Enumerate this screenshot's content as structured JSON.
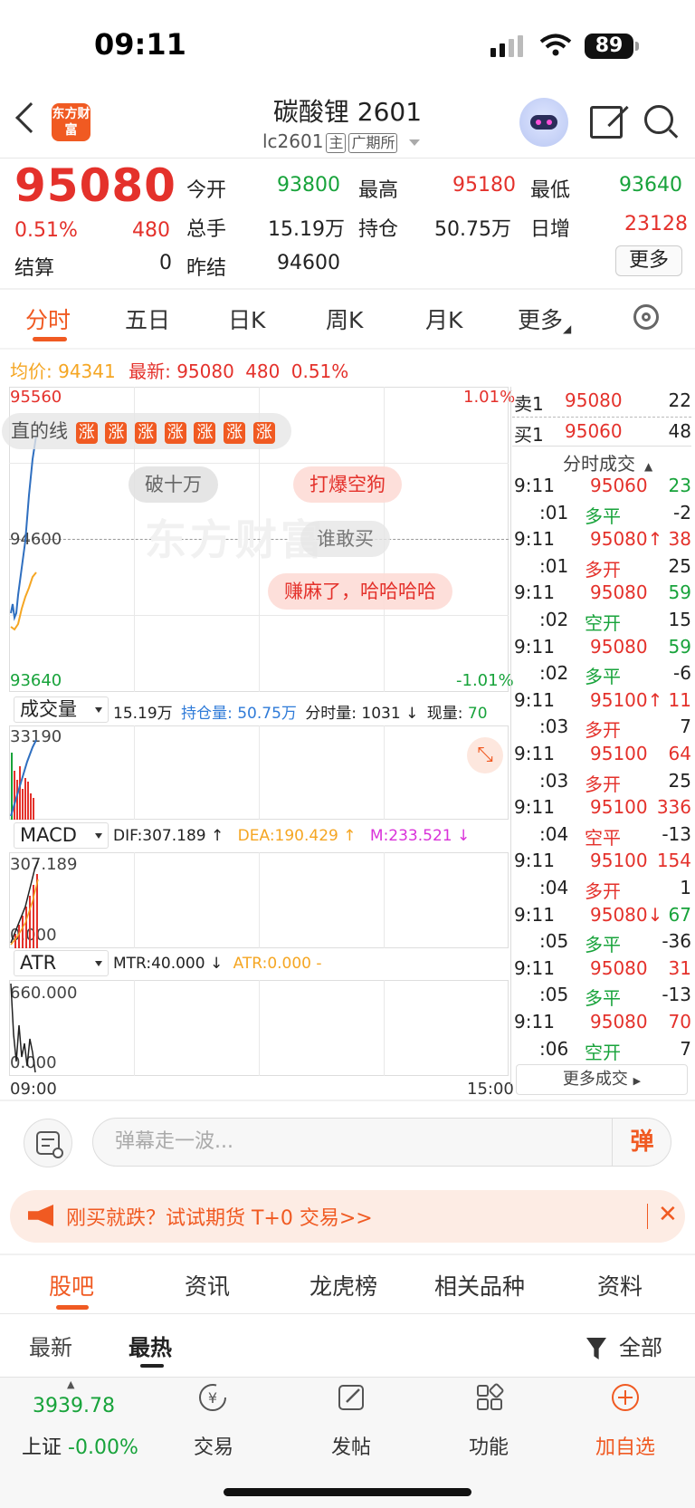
{
  "status": {
    "time": "09:11",
    "battery": "89"
  },
  "header": {
    "title": "碳酸锂 2601",
    "code": "lc2601",
    "tag_main": "主",
    "tag_exchange": "广期所",
    "logo_text": "东方财富"
  },
  "quote": {
    "price": "95080",
    "change_pct": "0.51%",
    "change": "480",
    "settle_label": "结算",
    "settle": "0",
    "open_label": "今开",
    "open": "93800",
    "high_label": "最高",
    "high": "95180",
    "low_label": "最低",
    "low": "93640",
    "volume_label": "总手",
    "volume": "15.19万",
    "oi_label": "持仓",
    "oi": "50.75万",
    "daily_inc_label": "日增",
    "daily_inc": "23128",
    "prev_settle_label": "昨结",
    "prev_settle": "94600",
    "more_label": "更多"
  },
  "tabs": [
    "分时",
    "五日",
    "日K",
    "周K",
    "月K",
    "更多"
  ],
  "legend": {
    "avg_label": "均价:",
    "avg": "94341",
    "latest_label": "最新:",
    "latest": "95080",
    "chg": "480",
    "pct": "0.51%"
  },
  "chart": {
    "y_top": "95560",
    "y_mid": "94600",
    "y_bot": "93640",
    "pct_top": "1.01%",
    "pct_bot": "-1.01%",
    "x_start": "09:00",
    "x_end": "15:00",
    "danmaku": [
      "直的线",
      "破十万",
      "打爆空狗",
      "谁敢买",
      "赚麻了，哈哈哈哈"
    ],
    "danmaku_rise": "涨",
    "watermark": "东方财富"
  },
  "volume_panel": {
    "selector": "成交量",
    "vol": "15.19万",
    "oi_label": "持仓量:",
    "oi": "50.75万",
    "min_vol": "分时量: 1031 ↓",
    "cur_label": "现量:",
    "cur": "70",
    "y_top": "33190"
  },
  "macd_panel": {
    "selector": "MACD",
    "dif": "DIF:307.189 ↑",
    "dea": "DEA:190.429 ↑",
    "m": "M:233.521 ↓",
    "y_top": "307.189",
    "y_bot": "0.000"
  },
  "atr_panel": {
    "selector": "ATR",
    "mtr": "MTR:40.000 ↓",
    "atr": "ATR:0.000 -",
    "y_top": "660.000",
    "y_bot": "0.000"
  },
  "orderbook": {
    "ask_label": "卖1",
    "ask": "95080",
    "ask_vol": "22",
    "bid_label": "买1",
    "bid": "95060",
    "bid_vol": "48"
  },
  "trades_title": "分时成交",
  "trades": [
    {
      "t": "9:11",
      "v": "95060",
      "n": "23",
      "vc": "red",
      "nc": "green"
    },
    {
      "t": ":01",
      "v": "多平",
      "n": "-2",
      "vc": "green",
      "nc": "dark"
    },
    {
      "t": "9:11",
      "v": "95080↑",
      "n": "38",
      "vc": "red",
      "nc": "red"
    },
    {
      "t": ":01",
      "v": "多开",
      "n": "25",
      "vc": "red",
      "nc": "dark"
    },
    {
      "t": "9:11",
      "v": "95080",
      "n": "59",
      "vc": "red",
      "nc": "green"
    },
    {
      "t": ":02",
      "v": "空开",
      "n": "15",
      "vc": "green",
      "nc": "dark"
    },
    {
      "t": "9:11",
      "v": "95080",
      "n": "59",
      "vc": "red",
      "nc": "green"
    },
    {
      "t": ":02",
      "v": "多平",
      "n": "-6",
      "vc": "green",
      "nc": "dark"
    },
    {
      "t": "9:11",
      "v": "95100↑",
      "n": "11",
      "vc": "red",
      "nc": "red"
    },
    {
      "t": ":03",
      "v": "多开",
      "n": "7",
      "vc": "red",
      "nc": "dark"
    },
    {
      "t": "9:11",
      "v": "95100",
      "n": "64",
      "vc": "red",
      "nc": "red"
    },
    {
      "t": ":03",
      "v": "多开",
      "n": "25",
      "vc": "red",
      "nc": "dark"
    },
    {
      "t": "9:11",
      "v": "95100",
      "n": "336",
      "vc": "red",
      "nc": "red"
    },
    {
      "t": ":04",
      "v": "空平",
      "n": "-13",
      "vc": "red",
      "nc": "dark"
    },
    {
      "t": "9:11",
      "v": "95100",
      "n": "154",
      "vc": "red",
      "nc": "red"
    },
    {
      "t": ":04",
      "v": "多开",
      "n": "1",
      "vc": "red",
      "nc": "dark"
    },
    {
      "t": "9:11",
      "v": "95080↓",
      "n": "67",
      "vc": "red",
      "nc": "green"
    },
    {
      "t": ":05",
      "v": "多平",
      "n": "-36",
      "vc": "green",
      "nc": "dark"
    },
    {
      "t": "9:11",
      "v": "95080",
      "n": "31",
      "vc": "red",
      "nc": "red"
    },
    {
      "t": ":05",
      "v": "多平",
      "n": "-13",
      "vc": "green",
      "nc": "dark"
    },
    {
      "t": "9:11",
      "v": "95080",
      "n": "70",
      "vc": "red",
      "nc": "red"
    },
    {
      "t": ":06",
      "v": "空开",
      "n": "7",
      "vc": "green",
      "nc": "dark"
    }
  ],
  "more_trades": "更多成交",
  "danmu": {
    "placeholder": "弹幕走一波...",
    "btn": "弹"
  },
  "promo": {
    "text": "刚买就跌？试试期货 T+0 交易>>"
  },
  "bottom_tabs": [
    "股吧",
    "资讯",
    "龙虎榜",
    "相关品种",
    "资料"
  ],
  "sub_tabs": {
    "latest": "最新",
    "hot": "最热",
    "filter": "全部"
  },
  "nav": {
    "index_value": "3939.78",
    "index_label": "上证",
    "index_chg": "-0.00%",
    "trade": "交易",
    "post": "发帖",
    "func": "功能",
    "add": "加自选"
  },
  "colors": {
    "up": "#e4312b",
    "down": "#18a33b",
    "accent": "#f05a22",
    "avg_line": "#f5a623",
    "price_line": "#2f6fc0"
  }
}
